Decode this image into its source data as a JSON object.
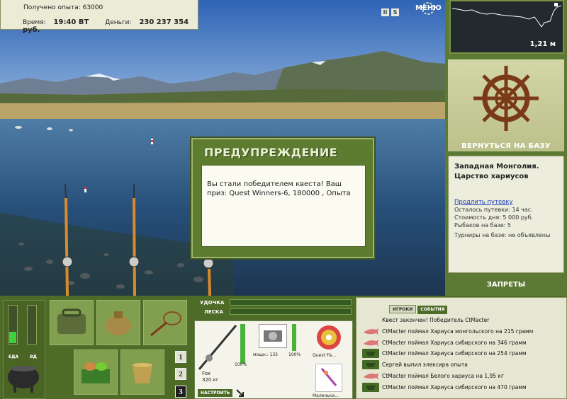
{
  "info": {
    "exp_label": "Получено опыта: 63000",
    "time_label": "Время:",
    "time_value": "19:40 ВТ",
    "money_label": "Деньги:",
    "money_value": "230 237 354 руб."
  },
  "top": {
    "pause_icon": "II",
    "sound_icon": "S",
    "menu_label": "МЕНЮ"
  },
  "depth": {
    "value": "1,21 м"
  },
  "side": {
    "return_label": "ВЕРНУТЬСЯ НА БАЗУ",
    "location_title": "Западная Монголия. Царство хариусов",
    "extend_link": "Продлить путевку",
    "remaining": "Осталось путевки: 14 час.",
    "day_cost": "Стоимость дня: 5 000 руб.",
    "fishers": "Рыбаков на базе: 5",
    "tournaments": "Турниры на базе: не объявлены",
    "bans_label": "ЗАПРЕТЫ"
  },
  "dialog": {
    "title": "ПРЕДУПРЕЖДЕНИЕ",
    "message": "Вы стали победителем квеста! Ваш приз: Quest Winners-6, 180000 , Опыта"
  },
  "status": {
    "food_label": "ЕДА",
    "food_level": 0.3,
    "water_label": "ВД",
    "water_level": 0.0
  },
  "rod": {
    "rod_label": "УДОЧКА",
    "line_label": "ЛЕСКА",
    "rod_level": 0.0,
    "line_level": 0.0,
    "rod_name": "Fox",
    "rod_weight": "320 кг",
    "rod_percent": "100%",
    "reel_label": "мощн.: 135",
    "reel_percent": "100%",
    "line_name": "Quest Fis...",
    "lure_name": "Маленька...",
    "setup_label": "НАСТРОИТЬ"
  },
  "rods_tabs": [
    "1",
    "2",
    "3"
  ],
  "events": {
    "tab_players": "ИГРОКИ",
    "tab_events": "СОБЫТИЯ",
    "items": [
      {
        "text": "Квест закончен! Победитель CtMacter",
        "icon": "none"
      },
      {
        "text": "CtMacter поймал Хариуса монгольского на 215 грамм",
        "icon": "fish-icon"
      },
      {
        "text": "CtMacter поймал Хариуса сибирского на 346 грамм",
        "icon": "fish-icon"
      },
      {
        "text": "CtMacter поймал Хариуса сибирского на 254 грамм",
        "icon": "net-icon"
      },
      {
        "text": "Сергей выпил элексира опыта",
        "icon": "net-icon"
      },
      {
        "text": "CtMacter поймал Белого хариуса на 1,95 кг",
        "icon": "fish-icon"
      },
      {
        "text": "CtMacter поймал Хариуса сибирского на 470 грамм",
        "icon": "net-icon"
      }
    ]
  },
  "colors": {
    "panel_green": "#5d7a34",
    "dark_green": "#4e6b28",
    "bar_green": "#3fd13b",
    "link_blue": "#1d3dbb"
  }
}
